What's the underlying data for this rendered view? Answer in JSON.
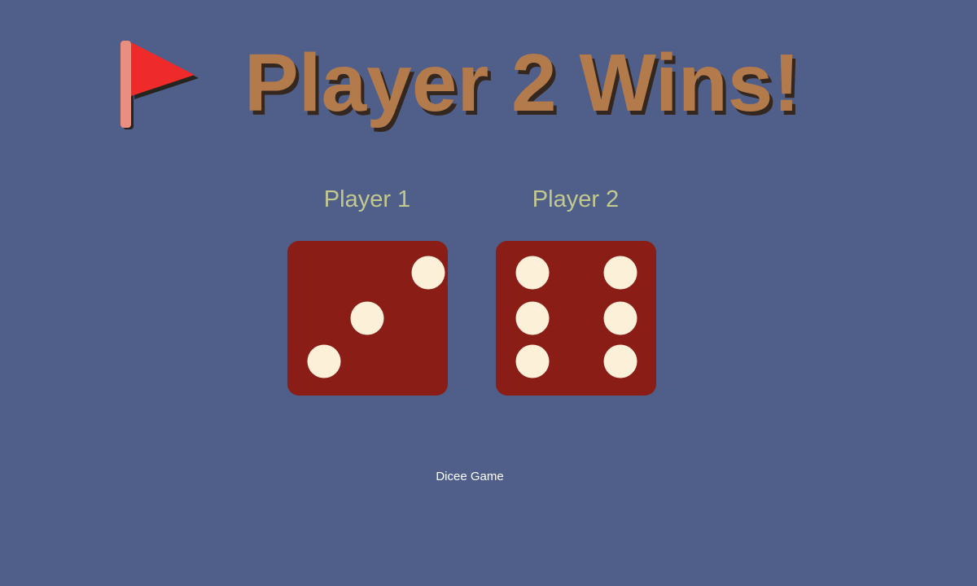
{
  "headline": {
    "icon": "flag-icon",
    "title": "Player 2 Wins!"
  },
  "players": [
    {
      "label": "Player 1",
      "die_value": 3
    },
    {
      "label": "Player 2",
      "die_value": 6
    }
  ],
  "footer": {
    "text": "Dicee Game"
  },
  "colors": {
    "background": "#4f5f8a",
    "title": "#b37a4c",
    "player_label": "#c2c98f",
    "die": "#8a1e17",
    "pip": "#fdf0d8",
    "flag": "#ee2a2a",
    "flag_pole": "#e98f80"
  }
}
